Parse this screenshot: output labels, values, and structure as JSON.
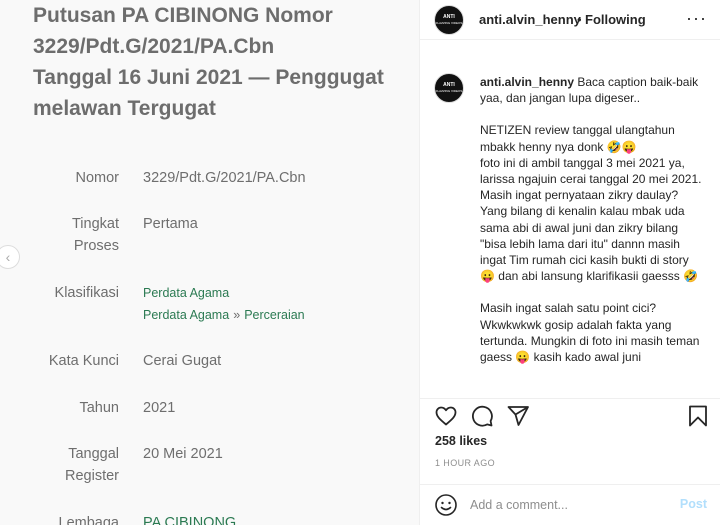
{
  "post_image": {
    "title_lines": [
      "Putusan PA CIBINONG Nomor",
      "3229/Pdt.G/2021/PA.Cbn",
      "Tanggal 16 Juni 2021 — Penggugat",
      "melawan Tergugat"
    ],
    "rows": {
      "nomor": {
        "label": "Nomor",
        "value": "3229/Pdt.G/2021/PA.Cbn"
      },
      "tingkat": {
        "label_line1": "Tingkat",
        "label_line2": "Proses",
        "value": "Pertama"
      },
      "klasifikasi": {
        "label": "Klasifikasi",
        "link1": "Perdata Agama",
        "link2": "Perdata Agama",
        "separator": "»",
        "link3": "Perceraian"
      },
      "kata_kunci": {
        "label": "Kata Kunci",
        "value": "Cerai Gugat"
      },
      "tahun": {
        "label": "Tahun",
        "value": "2021"
      },
      "register": {
        "label_line1": "Tanggal",
        "label_line2": "Register",
        "value": "20 Mei 2021"
      },
      "lembaga": {
        "label": "Lembaga",
        "value": "PA CIBINONG"
      }
    }
  },
  "header": {
    "username": "anti.alvin_henny",
    "dot": "•",
    "follow_status": "Following",
    "avatar_line1": "ANTI",
    "avatar_line2": "FLAZZING VIDEOS",
    "more": "···"
  },
  "caption": {
    "username": "anti.alvin_henny",
    "paragraphs": [
      "Baca caption baik-baik yaa, dan jangan lupa digeser..",
      "NETIZEN review tanggal ulangtahun mbakk henny nya donk 🤣😛\nfoto ini di ambil tanggal 3 mei 2021 ya, larissa ngajuin cerai tanggal 20 mei 2021.\nMasih ingat pernyataan zikry daulay? Yang bilang di kenalin kalau mbak uda sama abi di awal juni dan zikry bilang \"bisa lebih lama dari itu\" dannn masih ingat Tim rumah cici kasih bukti di story 😛 dan abi lansung klarifikasii gaesss 🤣",
      "Masih ingat salah satu point cici? Wkwkwkwk gosip adalah fakta yang tertunda. Mungkin di foto ini masih teman gaess 😛 kasih kado awal juni"
    ]
  },
  "actions": {
    "likes": "258 likes",
    "time": "1 HOUR AGO"
  },
  "comment": {
    "placeholder": "Add a comment...",
    "post_label": "Post"
  },
  "colors": {
    "link_green": "#2b7a52",
    "post_disabled": "#b2dffc",
    "text": "#262626",
    "muted": "#8e8e8e"
  }
}
